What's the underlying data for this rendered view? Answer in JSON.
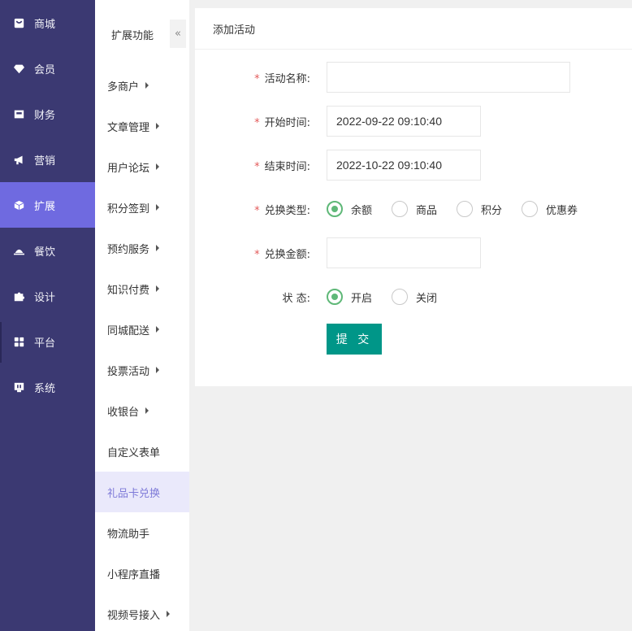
{
  "sidebar": {
    "items": [
      {
        "label": "商城",
        "icon": "shop-icon"
      },
      {
        "label": "会员",
        "icon": "diamond-icon"
      },
      {
        "label": "财务",
        "icon": "wallet-icon"
      },
      {
        "label": "营销",
        "icon": "megaphone-icon"
      },
      {
        "label": "扩展",
        "icon": "cube-icon"
      },
      {
        "label": "餐饮",
        "icon": "dish-icon"
      },
      {
        "label": "设计",
        "icon": "puzzle-icon"
      },
      {
        "label": "平台",
        "icon": "grid-icon"
      },
      {
        "label": "系统",
        "icon": "monitor-icon"
      }
    ],
    "active": "扩展",
    "bg_color": "#3b3972",
    "active_color": "#6f6ae0"
  },
  "submenu": {
    "title": "扩展功能",
    "collapse_label": "«",
    "items": [
      {
        "label": "多商户",
        "has_children": true
      },
      {
        "label": "文章管理",
        "has_children": true
      },
      {
        "label": "用户论坛",
        "has_children": true
      },
      {
        "label": "积分签到",
        "has_children": true
      },
      {
        "label": "预约服务",
        "has_children": true
      },
      {
        "label": "知识付费",
        "has_children": true
      },
      {
        "label": "同城配送",
        "has_children": true
      },
      {
        "label": "投票活动",
        "has_children": true
      },
      {
        "label": "收银台",
        "has_children": true
      },
      {
        "label": "自定义表单",
        "has_children": false
      },
      {
        "label": "礼品卡兑换",
        "has_children": false
      },
      {
        "label": "物流助手",
        "has_children": false
      },
      {
        "label": "小程序直播",
        "has_children": false
      },
      {
        "label": "视频号接入",
        "has_children": true
      }
    ],
    "active": "礼品卡兑换"
  },
  "form": {
    "title": "添加活动",
    "required_mark": "*",
    "name_label": "活动名称:",
    "name_value": "",
    "start_label": "开始时间:",
    "start_value": "2022-09-22 09:10:40",
    "end_label": "结束时间:",
    "end_value": "2022-10-22 09:10:40",
    "type_label": "兑换类型:",
    "type_options": [
      "余额",
      "商品",
      "积分",
      "优惠券"
    ],
    "type_selected": "余额",
    "amount_label": "兑换金额:",
    "amount_value": "",
    "status_label": "状 态:",
    "status_options": [
      "开启",
      "关闭"
    ],
    "status_selected": "开启",
    "submit_label": "提 交",
    "accent_color": "#009688",
    "radio_color": "#5fb878"
  }
}
